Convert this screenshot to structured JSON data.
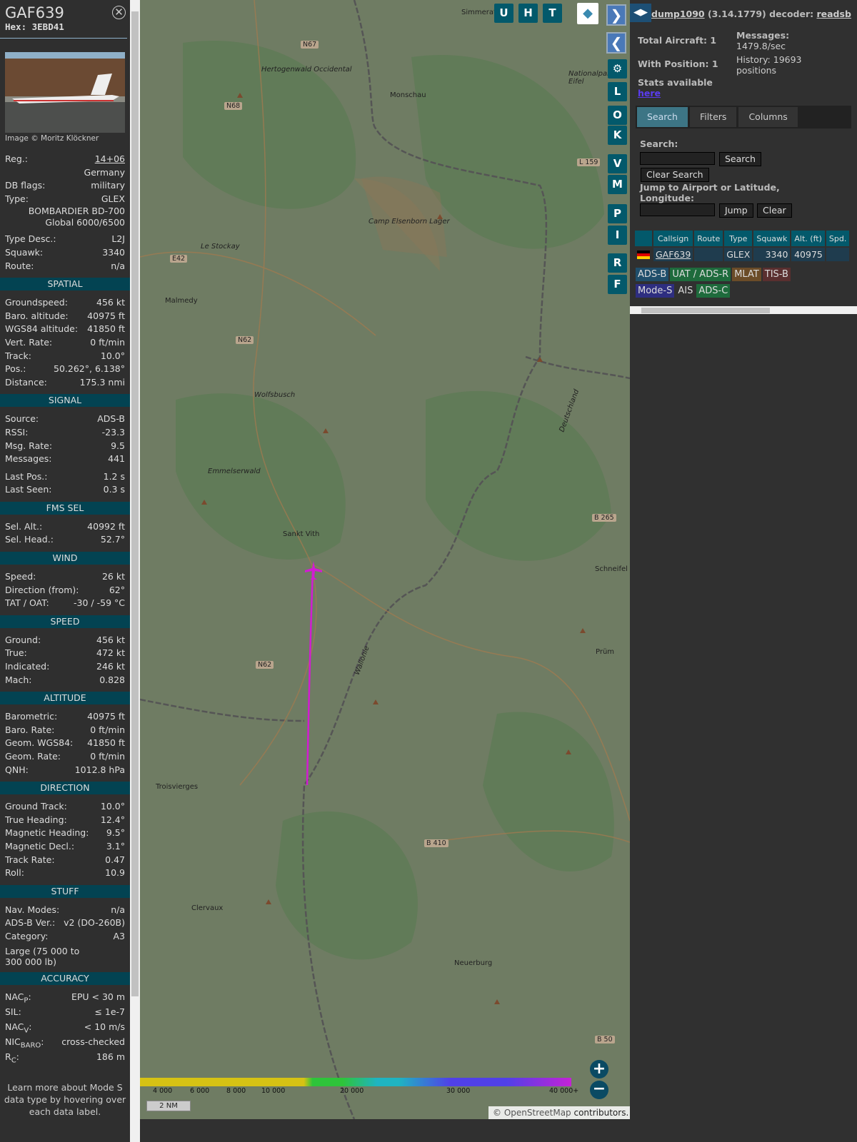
{
  "aircraft": {
    "callsign": "GAF639",
    "hex": "Hex: 3EBD41",
    "photo_caption": "Image © Moritz Klöckner",
    "reg_label": "Reg.:",
    "reg": "14+06",
    "country": "Germany",
    "dbflags_label": "DB flags:",
    "dbflags": "military",
    "type_label": "Type:",
    "type": "GLEX",
    "type_name1": "BOMBARDIER BD-700",
    "type_name2": "Global 6000/6500",
    "rows": [
      {
        "l": "Type Desc.:",
        "v": "L2J"
      },
      {
        "l": "Squawk:",
        "v": "3340"
      },
      {
        "l": "Route:",
        "v": "n/a"
      }
    ]
  },
  "sections": [
    {
      "title": "SPATIAL",
      "rows": [
        {
          "l": "Groundspeed:",
          "v": "456 kt"
        },
        {
          "l": "Baro. altitude:",
          "v": "40975 ft"
        },
        {
          "l": "WGS84 altitude:",
          "v": "41850 ft"
        },
        {
          "l": "Vert. Rate:",
          "v": "0 ft/min"
        },
        {
          "l": "Track:",
          "v": "10.0°"
        },
        {
          "l": "Pos.:",
          "v": "50.262°, 6.138°"
        },
        {
          "l": "Distance:",
          "v": "175.3 nmi"
        }
      ]
    },
    {
      "title": "SIGNAL",
      "rows": [
        {
          "l": "Source:",
          "v": "ADS-B"
        },
        {
          "l": "RSSI:",
          "v": "-23.3"
        },
        {
          "l": "Msg. Rate:",
          "v": "9.5"
        },
        {
          "l": "Messages:",
          "v": "441"
        },
        {
          "l": "Last Pos.:",
          "v": "1.2 s"
        },
        {
          "l": "Last Seen:",
          "v": "0.3 s"
        }
      ]
    },
    {
      "title": "FMS SEL",
      "rows": [
        {
          "l": "Sel. Alt.:",
          "v": "40992 ft"
        },
        {
          "l": "Sel. Head.:",
          "v": "52.7°"
        }
      ]
    },
    {
      "title": "WIND",
      "rows": [
        {
          "l": "Speed:",
          "v": "26 kt"
        },
        {
          "l": "Direction (from):",
          "v": "62°"
        },
        {
          "l": "TAT / OAT:",
          "v": "-30 / -59 °C"
        }
      ]
    },
    {
      "title": "SPEED",
      "rows": [
        {
          "l": "Ground:",
          "v": "456 kt"
        },
        {
          "l": "True:",
          "v": "472 kt"
        },
        {
          "l": "Indicated:",
          "v": "246 kt"
        },
        {
          "l": "Mach:",
          "v": "0.828"
        }
      ]
    },
    {
      "title": "ALTITUDE",
      "rows": [
        {
          "l": "Barometric:",
          "v": "40975 ft"
        },
        {
          "l": "Baro. Rate:",
          "v": "0 ft/min"
        },
        {
          "l": "Geom. WGS84:",
          "v": "41850 ft"
        },
        {
          "l": "Geom. Rate:",
          "v": "0 ft/min"
        },
        {
          "l": "QNH:",
          "v": "1012.8 hPa"
        }
      ]
    },
    {
      "title": "DIRECTION",
      "rows": [
        {
          "l": "Ground Track:",
          "v": "10.0°"
        },
        {
          "l": "True Heading:",
          "v": "12.4°"
        },
        {
          "l": "Magnetic Heading:",
          "v": "9.5°"
        },
        {
          "l": "Magnetic Decl.:",
          "v": "3.1°"
        },
        {
          "l": "Track Rate:",
          "v": "0.47"
        },
        {
          "l": "Roll:",
          "v": "10.9"
        }
      ]
    },
    {
      "title": "STUFF",
      "rows": [
        {
          "l": "Nav. Modes:",
          "v": "n/a"
        },
        {
          "l": "ADS-B Ver.:",
          "v": "v2 (DO-260B)"
        },
        {
          "l": "Category:",
          "v": "A3"
        }
      ],
      "note": "Large (75 000 to 300 000 lb)"
    },
    {
      "title": "ACCURACY",
      "rows": [
        {
          "l": "NAC",
          "sub": "P",
          "v": "EPU < 30 m"
        },
        {
          "l": "SIL",
          "sub": "",
          "v": "≤ 1e-7"
        },
        {
          "l": "NAC",
          "sub": "V",
          "v": "< 10 m/s"
        },
        {
          "l": "NIC",
          "sub": "BARO",
          "v": "cross-checked"
        },
        {
          "l": "R",
          "sub": "C",
          "v": "186 m"
        }
      ]
    }
  ],
  "footer_note": "Learn more about Mode S data type by hovering over each data label.",
  "map": {
    "buttons_top": [
      "U",
      "H",
      "T"
    ],
    "buttons_side": [
      "L",
      "O",
      "K",
      "V",
      "M",
      "P",
      "I",
      "R",
      "F"
    ],
    "labels": [
      "Simmerath",
      "Hertogenwald Occidental",
      "N67",
      "N68",
      "Monschau",
      "Nationalpark Eifel",
      "Camp Elsenborn Lager",
      "L 159",
      "Le Stockay",
      "E42",
      "Malmedy",
      "N62",
      "Wolfsbusch",
      "Emmelserwald",
      "Sankt Vith",
      "B 265",
      "Schneifel",
      "N62",
      "Prüm",
      "Troisvierges",
      "B 410",
      "Clervaux",
      "Neuerburg",
      "B 50",
      "Wallonie",
      "Deutschland"
    ],
    "legend_ticks": [
      "4 000",
      "6 000",
      "8 000",
      "10 000",
      "20 000",
      "30 000",
      "40 000+"
    ],
    "scale": "2 NM",
    "attribution_prefix": "© ",
    "attribution_link": "OpenStreetMap",
    "attribution_suffix": " contributors.",
    "track_color": "#d21cd2"
  },
  "panel": {
    "title_link": "dump1090",
    "title_rest": " (3.14.1779) decoder: ",
    "decoder": "readsb",
    "total_aircraft": "Total Aircraft: 1",
    "with_position": "With Position: 1",
    "messages_label": "Messages:",
    "messages": "1479.8/sec",
    "history": "History: 19693 positions",
    "stats": "Stats available",
    "stats_link": "here",
    "tabs": [
      "Search",
      "Filters",
      "Columns"
    ],
    "search_label": "Search:",
    "search_btn": "Search",
    "clear_search": "Clear Search",
    "jump_label": "Jump to Airport or Latitude, Longitude:",
    "jump_btn": "Jump",
    "clear_btn": "Clear",
    "columns": [
      "Callsign",
      "Route",
      "Type",
      "Squawk",
      "Alt. (ft)",
      "Spd."
    ],
    "rows": [
      {
        "callsign": "GAF639",
        "route": "",
        "type": "GLEX",
        "squawk": "3340",
        "alt": "40975",
        "spd": ""
      }
    ],
    "sources": [
      {
        "t": "ADS-B",
        "c": "#1f4e6b"
      },
      {
        "t": "UAT / ADS-R",
        "c": "#1e6b3c"
      },
      {
        "t": "MLAT",
        "c": "#6b4c28"
      },
      {
        "t": "TIS-B",
        "c": "#5a2f2f"
      },
      {
        "t": "Mode-S",
        "c": "#2e2e80"
      },
      {
        "t": "AIS",
        "c": "transparent"
      },
      {
        "t": "ADS-C",
        "c": "#1e6b3c"
      }
    ]
  }
}
